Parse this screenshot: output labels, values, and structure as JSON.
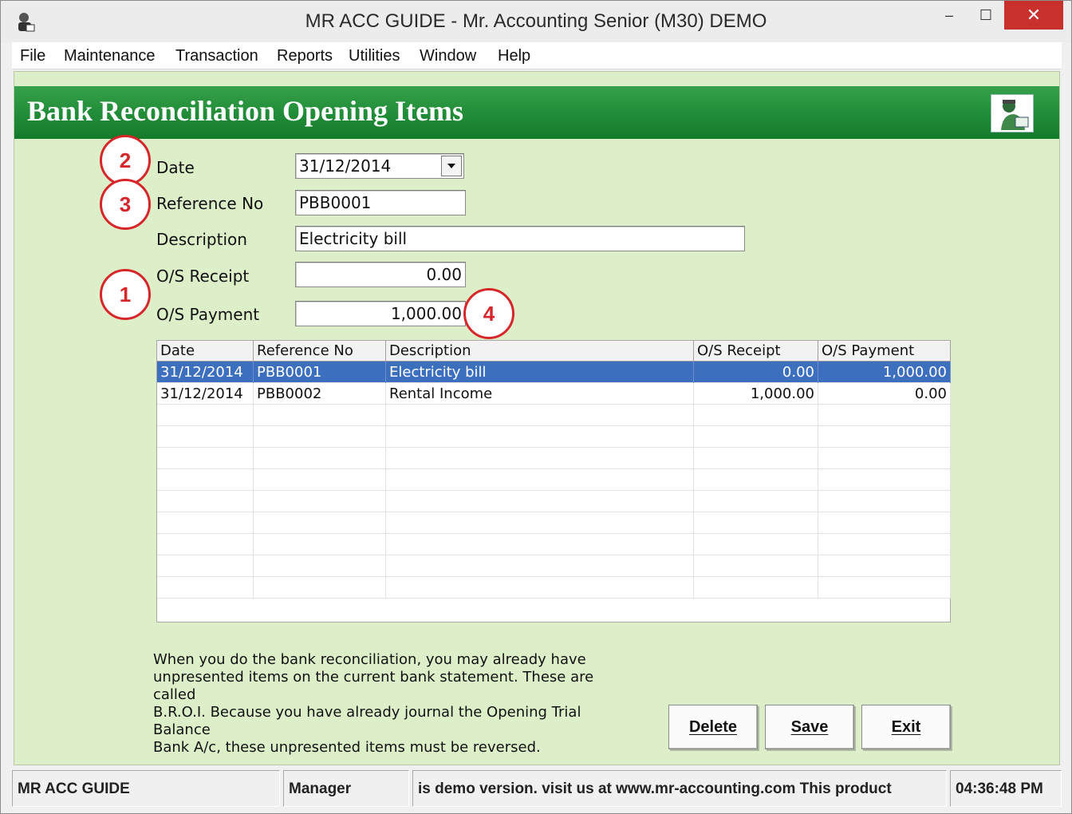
{
  "window": {
    "title": "MR ACC GUIDE - Mr. Accounting Senior (M30) DEMO",
    "minimize": "–",
    "maximize": "☐",
    "close": "✕"
  },
  "menu": [
    "File",
    "Maintenance",
    "Transaction",
    "Reports",
    "Utilities",
    "Window",
    "Help"
  ],
  "form": {
    "title": "Bank Reconciliation Opening Items",
    "labels": {
      "date": "Date",
      "reference": "Reference No",
      "description": "Description",
      "os_receipt": "O/S Receipt",
      "os_payment": "O/S Payment"
    },
    "values": {
      "date": "31/12/2014",
      "reference": "PBB0001",
      "description": "Electricity bill",
      "os_receipt": "0.00",
      "os_payment": "1,000.00"
    }
  },
  "badges": {
    "one": "1",
    "two": "2",
    "three": "3",
    "four": "4"
  },
  "grid": {
    "columns": [
      "Date",
      "Reference No",
      "Description",
      "O/S Receipt",
      "O/S Payment"
    ],
    "rows": [
      [
        "31/12/2014",
        "PBB0001",
        "Electricity bill",
        "0.00",
        "1,000.00"
      ],
      [
        "31/12/2014",
        "PBB0002",
        "Rental Income",
        "1,000.00",
        "0.00"
      ]
    ]
  },
  "note": {
    "line1": "When you do the bank reconciliation, you may already have",
    "line2": "unpresented items on the current bank statement. These are called",
    "line3": "B.R.O.I. Because you have already journal the Opening Trial Balance",
    "line4": "Bank A/c, these unpresented items must be reversed."
  },
  "buttons": {
    "delete": "Delete",
    "save": "Save",
    "exit": "Exit"
  },
  "status": {
    "app": "MR ACC GUIDE",
    "user": "Manager",
    "message": "is demo version.  visit us at www.mr-accounting.com This product",
    "time": "04:36:48 PM"
  },
  "colors": {
    "banner": "#1f8a36",
    "form_bg": "#dcefc9",
    "selection": "#3d6fbf",
    "badge": "#d6262a"
  },
  "icons": [
    "app-icon",
    "dropdown-arrow-icon",
    "accountant-logo-icon"
  ]
}
